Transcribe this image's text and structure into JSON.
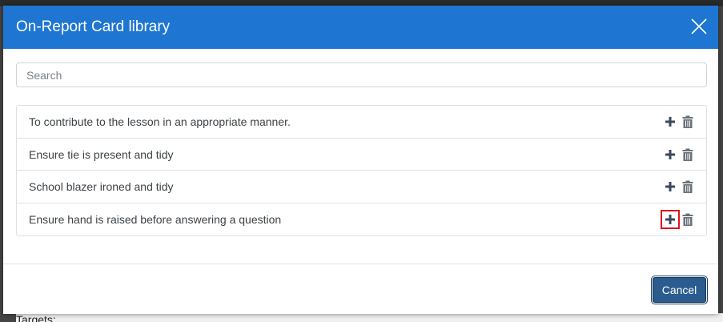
{
  "background": {
    "partial_text": "Targets:"
  },
  "dialog": {
    "title": "On-Report Card library",
    "close_icon": "close-icon",
    "search": {
      "placeholder": "Search",
      "value": ""
    },
    "items": [
      {
        "label": "To contribute to the lesson in an appropriate manner."
      },
      {
        "label": "Ensure tie is present and tidy"
      },
      {
        "label": "School blazer ironed and tidy"
      },
      {
        "label": "Ensure hand is raised before answering a question"
      }
    ],
    "item_icons": {
      "add": "plus-icon",
      "delete": "trash-icon"
    },
    "cancel_label": "Cancel"
  },
  "colors": {
    "header": "#1e76d2",
    "highlight": "#e0151b",
    "cancel": "#2b5c8f"
  }
}
